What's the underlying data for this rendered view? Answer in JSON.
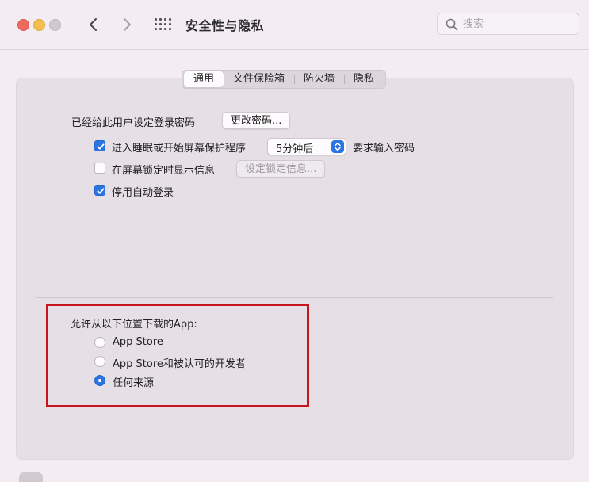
{
  "window": {
    "title": "安全性与隐私"
  },
  "search": {
    "placeholder": "搜索"
  },
  "tabs": [
    {
      "label": "通用",
      "active": true
    },
    {
      "label": "文件保险箱",
      "active": false
    },
    {
      "label": "防火墙",
      "active": false
    },
    {
      "label": "隐私",
      "active": false
    }
  ],
  "general": {
    "password_label": "已经给此用户设定登录密码",
    "change_password_button": "更改密码...",
    "sleep_option": {
      "label": "进入睡眠或开始屏幕保护程序",
      "checked": true,
      "delay_value": "5分钟后",
      "suffix": "要求输入密码"
    },
    "lock_message_option": {
      "label": "在屏幕锁定时显示信息",
      "checked": false,
      "button": "设定锁定信息..."
    },
    "disable_autologin_option": {
      "label": "停用自动登录",
      "checked": true
    }
  },
  "downloads": {
    "title": "允许从以下位置下载的App:",
    "options": [
      {
        "label": "App Store",
        "selected": false
      },
      {
        "label": "App Store和被认可的开发者",
        "selected": false
      },
      {
        "label": "任何来源",
        "selected": true
      }
    ]
  },
  "colors": {
    "accent": "#2b74e4",
    "highlight_border": "#c8141c"
  }
}
